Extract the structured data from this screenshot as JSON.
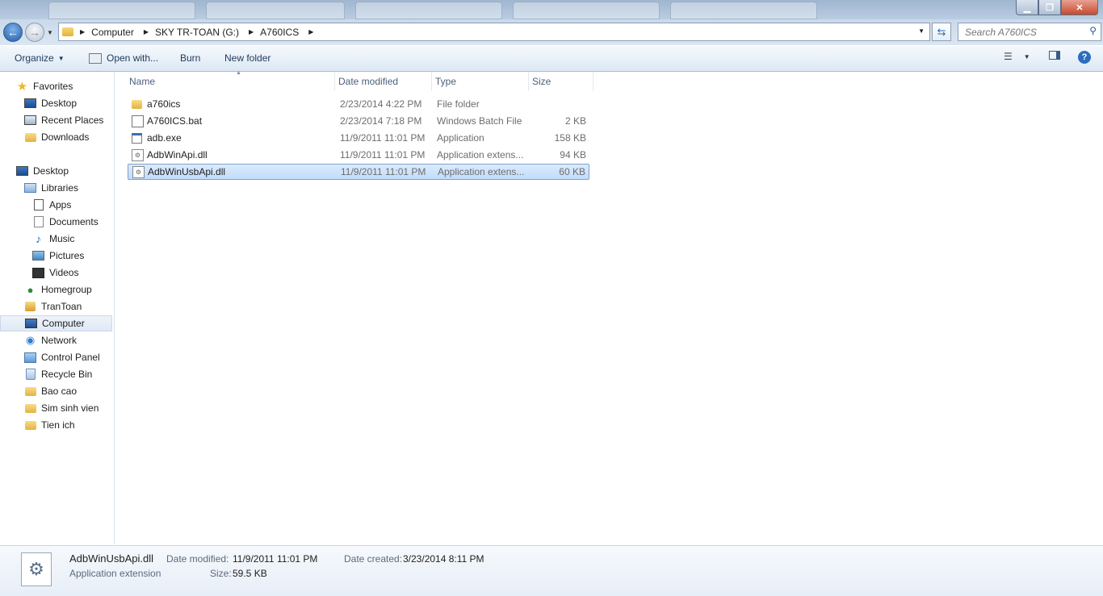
{
  "window": {
    "controls": {
      "minimize_icon": "minimize-icon",
      "maximize_icon": "maximize-icon",
      "close_icon": "close-icon"
    }
  },
  "address_bar": {
    "breadcrumbs": [
      "Computer",
      "SKY TR-TOAN (G:)",
      "A760ICS"
    ]
  },
  "search": {
    "placeholder": "Search A760ICS"
  },
  "toolbar": {
    "organize": "Organize",
    "open_with": "Open with...",
    "burn": "Burn",
    "new_folder": "New folder"
  },
  "navigation": {
    "favorites": {
      "label": "Favorites",
      "items": [
        "Desktop",
        "Recent Places",
        "Downloads"
      ]
    },
    "desktop": {
      "label": "Desktop",
      "libraries": {
        "label": "Libraries",
        "items": [
          "Apps",
          "Documents",
          "Music",
          "Pictures",
          "Videos"
        ]
      },
      "items": [
        "Homegroup",
        "TranToan",
        "Computer",
        "Network",
        "Control Panel",
        "Recycle Bin",
        "Bao cao",
        "Sim sinh vien",
        "Tien ich"
      ],
      "selected": "Computer"
    }
  },
  "columns": [
    "Name",
    "Date modified",
    "Type",
    "Size"
  ],
  "files": [
    {
      "name": "a760ics",
      "date": "2/23/2014 4:22 PM",
      "type": "File folder",
      "size": "",
      "icon": "folder-icon"
    },
    {
      "name": "A760ICS.bat",
      "date": "2/23/2014 7:18 PM",
      "type": "Windows Batch File",
      "size": "2 KB",
      "icon": "batch-file-icon"
    },
    {
      "name": "adb.exe",
      "date": "11/9/2011 11:01 PM",
      "type": "Application",
      "size": "158 KB",
      "icon": "exe-file-icon"
    },
    {
      "name": "AdbWinApi.dll",
      "date": "11/9/2011 11:01 PM",
      "type": "Application extens...",
      "size": "94 KB",
      "icon": "dll-file-icon"
    },
    {
      "name": "AdbWinUsbApi.dll",
      "date": "11/9/2011 11:01 PM",
      "type": "Application extens...",
      "size": "60 KB",
      "icon": "dll-file-icon",
      "selected": true
    }
  ],
  "details_pane": {
    "name": "AdbWinUsbApi.dll",
    "type": "Application extension",
    "date_modified_label": "Date modified:",
    "date_modified": "11/9/2011 11:01 PM",
    "date_created_label": "Date created:",
    "date_created": "3/23/2014 8:11 PM",
    "size_label": "Size:",
    "size": "59.5 KB"
  },
  "colors": {
    "selection": "#c1dcfc",
    "accent": "#1e395b",
    "nav_bg": "#c9d9eb"
  }
}
